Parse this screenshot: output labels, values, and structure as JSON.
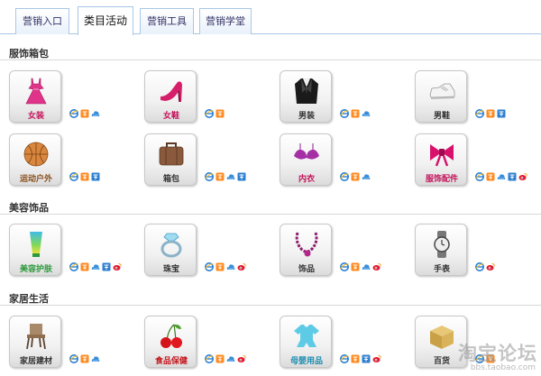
{
  "tabs": [
    {
      "label": "营销入口"
    },
    {
      "label": "类目活动"
    },
    {
      "label": "营销工具"
    },
    {
      "label": "营销学堂"
    }
  ],
  "sections": [
    {
      "title": "服饰箱包",
      "items": [
        {
          "label": "女装",
          "icon": "dress-icon",
          "badges": [
            "ie",
            "tao",
            "cloud"
          ]
        },
        {
          "label": "女鞋",
          "icon": "high-heel-icon",
          "badges": [
            "ie",
            "tao"
          ]
        },
        {
          "label": "男装",
          "icon": "mens-suit-icon",
          "badges": [
            "ie",
            "tao",
            "cloud"
          ]
        },
        {
          "label": "男鞋",
          "icon": "sneaker-icon",
          "badges": [
            "ie",
            "tao",
            "taobao"
          ]
        },
        {
          "label": "运动户外",
          "icon": "basketball-icon",
          "badges": [
            "ie",
            "tao",
            "taobao"
          ]
        },
        {
          "label": "箱包",
          "icon": "suitcase-icon",
          "badges": [
            "ie",
            "tao",
            "cloud",
            "taobao"
          ]
        },
        {
          "label": "内衣",
          "icon": "bra-icon",
          "badges": [
            "ie",
            "tao",
            "cloud"
          ]
        },
        {
          "label": "服饰配件",
          "icon": "bow-icon",
          "badges": [
            "ie",
            "tao",
            "cloud",
            "taobao",
            "weibo"
          ]
        }
      ]
    },
    {
      "title": "美容饰品",
      "items": [
        {
          "label": "美容护肤",
          "icon": "cosmetic-tube-icon",
          "badges": [
            "ie",
            "tao",
            "cloud",
            "taobao",
            "weibo"
          ]
        },
        {
          "label": "珠宝",
          "icon": "ring-icon",
          "badges": [
            "ie",
            "tao",
            "cloud",
            "weibo"
          ]
        },
        {
          "label": "饰品",
          "icon": "necklace-icon",
          "badges": [
            "ie",
            "tao",
            "cloud",
            "weibo"
          ]
        },
        {
          "label": "手表",
          "icon": "watch-icon",
          "badges": [
            "ie",
            "weibo"
          ]
        }
      ]
    },
    {
      "title": "家居生活",
      "items": [
        {
          "label": "家居建材",
          "icon": "chair-icon",
          "badges": [
            "ie",
            "tao",
            "cloud"
          ]
        },
        {
          "label": "食品保健",
          "icon": "cherry-icon",
          "badges": [
            "ie",
            "tao",
            "cloud",
            "weibo"
          ]
        },
        {
          "label": "母婴用品",
          "icon": "baby-clothes-icon",
          "badges": [
            "ie",
            "tao",
            "taobao",
            "weibo"
          ]
        },
        {
          "label": "百货",
          "icon": "box-icon",
          "badges": [
            "ie",
            "tao"
          ]
        }
      ]
    }
  ],
  "watermark": {
    "main": "淘宝论坛",
    "sub": "bbs.taobao.com"
  },
  "colors": {
    "tab_border": "#a9c7e6",
    "label_pink": "#c4145c",
    "divider": "#d9d9d9"
  }
}
